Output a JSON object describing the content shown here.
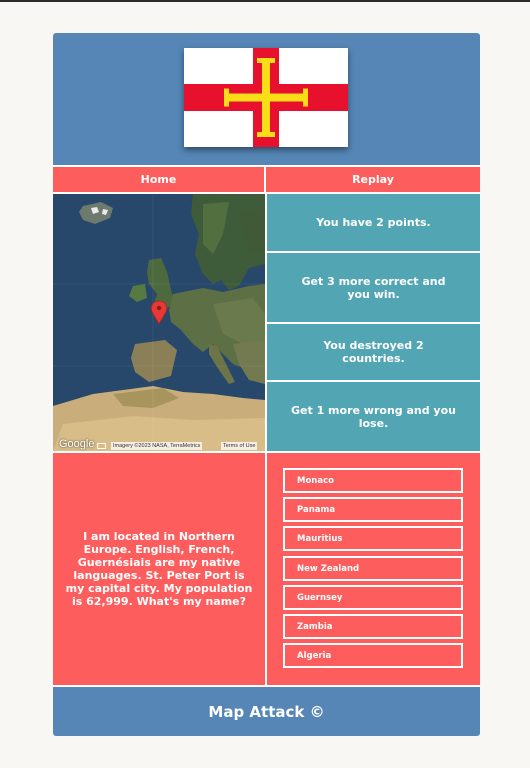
{
  "app": {
    "flag": {
      "country": "Guernsey",
      "colors": {
        "field": "#ffffff",
        "cross": "#e8112d",
        "inner_cross": "#f9dd16"
      }
    },
    "nav": {
      "home_label": "Home",
      "replay_label": "Replay"
    },
    "map": {
      "google_label": "Google",
      "attribution": "Imagery ©2023 NASA, TerraMetrics",
      "terms": "Terms of Use",
      "marker_icon": "map-pin-icon",
      "keyboard_icon": "keyboard-icon"
    },
    "stats": {
      "points": "You have 2 points.",
      "to_win": "Get 3 more correct and you win.",
      "destroyed": "You destroyed 2 countries.",
      "to_lose": "Get 1 more wrong and you lose."
    },
    "question": "I am located in Northern Europe. English, French, Guernésiais are my native languages. St. Peter Port is my capital city. My population is 62,999. What's my name?",
    "answers": [
      "Monaco",
      "Panama",
      "Mauritius",
      "New Zealand",
      "Guernsey",
      "Zambia",
      "Algeria"
    ],
    "footer": "Map Attack ©",
    "colors": {
      "blue": "#5586b6",
      "red": "#fd5d5d",
      "teal": "#52a6b4",
      "background": "#f9f7f3"
    }
  }
}
